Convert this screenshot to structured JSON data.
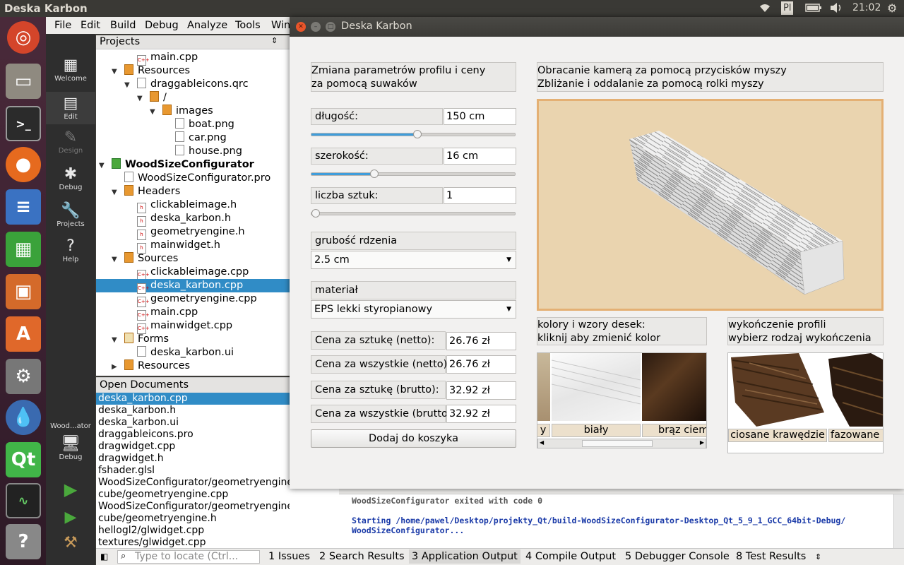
{
  "topbar": {
    "title": "Deska Karbon",
    "keyboard": "Pl",
    "time": "21:02"
  },
  "menubar": [
    "File",
    "Edit",
    "Build",
    "Debug",
    "Analyze",
    "Tools",
    "Win"
  ],
  "modes": [
    {
      "label": "Welcome",
      "icon": "grid-icon"
    },
    {
      "label": "Edit",
      "icon": "document-icon"
    },
    {
      "label": "Design",
      "icon": "pen-icon"
    },
    {
      "label": "Debug",
      "icon": "bug-icon"
    },
    {
      "label": "Projects",
      "icon": "wrench-icon"
    },
    {
      "label": "Help",
      "icon": "question-icon"
    }
  ],
  "kit": {
    "name": "Wood...ator",
    "mode": "Debug"
  },
  "projects_panel": {
    "title": "Projects",
    "tree": [
      "main.cpp",
      "Resources",
      "draggableicons.qrc",
      "/",
      "images",
      "boat.png",
      "car.png",
      "house.png",
      "WoodSizeConfigurator",
      "WoodSizeConfigurator.pro",
      "Headers",
      "clickableimage.h",
      "deska_karbon.h",
      "geometryengine.h",
      "mainwidget.h",
      "Sources",
      "clickableimage.cpp",
      "deska_karbon.cpp",
      "geometryengine.cpp",
      "main.cpp",
      "mainwidget.cpp",
      "Forms",
      "deska_karbon.ui",
      "Resources"
    ]
  },
  "open_documents": {
    "title": "Open Documents",
    "items": [
      "deska_karbon.cpp",
      "deska_karbon.h",
      "deska_karbon.ui",
      "draggableicons.pro",
      "dragwidget.cpp",
      "dragwidget.h",
      "fshader.glsl",
      "WoodSizeConfigurator/geometryengine",
      "cube/geometryengine.cpp",
      "WoodSizeConfigurator/geometryengine.h",
      "cube/geometryengine.h",
      "hellogl2/glwidget.cpp",
      "textures/glwidget.cpp"
    ]
  },
  "output": {
    "line1": "WoodSizeConfigurator exited with code 0",
    "line2": "Starting /home/pawel/Desktop/projekty_Qt/build-WoodSizeConfigurator-Desktop_Qt_5_9_1_GCC_64bit-Debug/",
    "line3": "WoodSizeConfigurator..."
  },
  "statusbar": {
    "locate_placeholder": "Type to locate (Ctrl...",
    "tabs": [
      "1  Issues",
      "2  Search Results",
      "3  Application Output",
      "4  Compile Output",
      "5  Debugger Console",
      "8  Test Results"
    ]
  },
  "app": {
    "title": "Deska Karbon",
    "params_header_1": "Zmiana parametrów profilu i ceny",
    "params_header_2": "za pomocą suwaków",
    "length_label": "długość:",
    "length_value": "150 cm",
    "length_slider": 0.52,
    "width_label": "szerokość:",
    "width_value": "16 cm",
    "width_slider": 0.31,
    "count_label": "liczba sztuk:",
    "count_value": "1",
    "count_slider": 0.0,
    "core_label": "grubość rdzenia",
    "core_value": "2.5 cm",
    "material_label": "materiał",
    "material_value": "EPS lekki styropianowy",
    "prices": [
      {
        "label": "Cena za sztukę (netto):",
        "value": "26.76 zł"
      },
      {
        "label": "Cena za wszystkie (netto):",
        "value": "26.76 zł"
      },
      {
        "label": "Cena za sztukę (brutto):",
        "value": "32.92 zł"
      },
      {
        "label": "Cena za wszystkie (brutto):",
        "value": "32.92 zł"
      }
    ],
    "add_button": "Dodaj do koszyka",
    "camera_header_1": "Obracanie kamerą za pomocą przycisków myszy",
    "camera_header_2": "Zbliżanie i oddalanie za pomocą rolki myszy",
    "colors_header_1": "kolory i wzory desek:",
    "colors_header_2": "kliknij aby zmienić kolor",
    "colors": [
      "y",
      "biały",
      "brąz ciemn"
    ],
    "finish_header_1": "wykończenie profili",
    "finish_header_2": "wybierz rodzaj wykończenia",
    "finishes": [
      "ciosane krawędzie",
      "fazowane k"
    ]
  },
  "colors": {
    "accent": "#308cc6",
    "slider_fill": "#3f9ddb",
    "view_bg": "#ead4af",
    "view_border": "#e4b074"
  }
}
